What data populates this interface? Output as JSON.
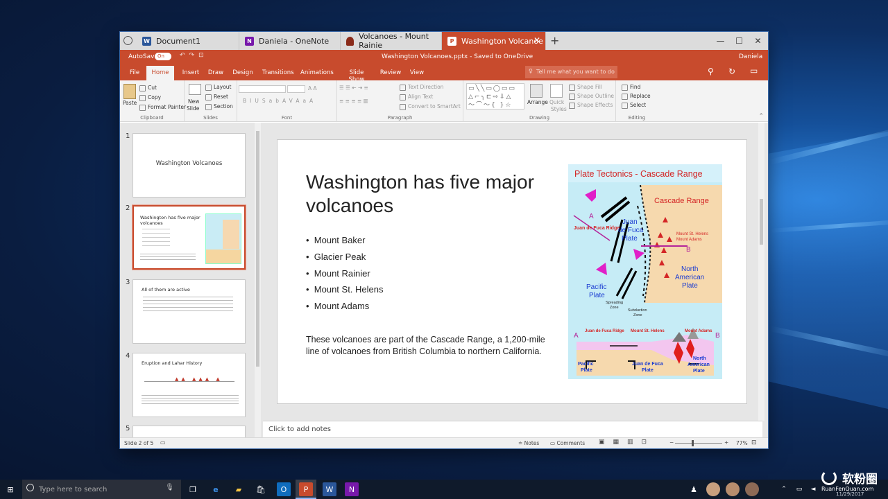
{
  "browser_tabs": [
    {
      "label": "Document1",
      "icon": "word-icon",
      "color": "#2b579a"
    },
    {
      "label": "Daniela - OneNote",
      "icon": "onenote-icon",
      "color": "#7719aa"
    },
    {
      "label": "Volcanoes - Mount Rainie",
      "icon": "shield-icon",
      "color": "#8a2b1a"
    },
    {
      "label": "Washington Volcanoe",
      "icon": "powerpoint-icon",
      "color": "#ffffff"
    }
  ],
  "titlebar": {
    "autosave": "AutoSave",
    "autosave_state": "On",
    "filename": "Washington Volcanoes.pptx - Saved to OneDrive",
    "user": "Daniela"
  },
  "ribbon_tabs": [
    "File",
    "Home",
    "Insert",
    "Draw",
    "Design",
    "Transitions",
    "Animations",
    "Slide Show",
    "Review",
    "View"
  ],
  "tell_me": "Tell me what you want to do",
  "ribbon": {
    "clipboard": {
      "paste": "Paste",
      "cut": "Cut",
      "copy": "Copy",
      "format_painter": "Format Painter",
      "label": "Clipboard"
    },
    "slides": {
      "new_slide_1": "New",
      "new_slide_2": "Slide",
      "layout": "Layout",
      "reset": "Reset",
      "section": "Section",
      "label": "Slides"
    },
    "font": {
      "label": "Font",
      "bold": "B",
      "italic": "I",
      "underline": "U",
      "strike": "S",
      "shadow": "ab",
      "spacing": "AV",
      "case": "Aa",
      "color": "A"
    },
    "paragraph": {
      "text_direction": "Text Direction",
      "align_text": "Align Text",
      "convert": "Convert to SmartArt",
      "label": "Paragraph"
    },
    "drawing": {
      "arrange": "Arrange",
      "quick_1": "Quick",
      "quick_2": "Styles",
      "shape_fill": "Shape Fill",
      "shape_outline": "Shape Outline",
      "shape_effects": "Shape Effects",
      "label": "Drawing"
    },
    "editing": {
      "find": "Find",
      "replace": "Replace",
      "select": "Select",
      "label": "Editing"
    }
  },
  "thumbnails": [
    {
      "num": "1",
      "title": "Washington Volcanoes"
    },
    {
      "num": "2",
      "title": "Washington has five major volcanoes"
    },
    {
      "num": "3",
      "title": "All of them are active"
    },
    {
      "num": "4",
      "title": "Eruption and Lahar History"
    },
    {
      "num": "5",
      "title": ""
    }
  ],
  "slide": {
    "title": "Washington has five major volcanoes",
    "bullets": [
      "Mount Baker",
      "Glacier Peak",
      "Mount Rainier",
      "Mount St. Helens",
      "Mount Adams"
    ],
    "paragraph": "These volcanoes are part of the Cascade Range, a 1,200-mile line of volcanoes from British Columbia to northern California."
  },
  "figure": {
    "title": "Plate Tectonics - Cascade Range",
    "cascade_range": "Cascade Range",
    "a": "A",
    "b": "B",
    "ridge": "Juan de Fuca Ridge",
    "jdf_plate_1": "Juan",
    "jdf_plate_2": "de Fuca",
    "jdf_plate_3": "Plate",
    "st_helens": "Mount St. Helens",
    "mt_adams": "Mount Adams",
    "na_1": "North",
    "na_2": "American",
    "na_3": "Plate",
    "pac_1": "Pacific",
    "pac_2": "Plate",
    "spreading_1": "Spreading",
    "spreading_2": "Zone",
    "subduction_1": "Subduction",
    "subduction_2": "Zone",
    "cs_ridge": "Juan de Fuca Ridge",
    "cs_helens": "Mount St. Helens",
    "cs_adams": "Mount Adams",
    "cs_pac_1": "Pacific",
    "cs_pac_2": "Plate",
    "cs_jdf_1": "Juan de Fuca",
    "cs_jdf_2": "Plate",
    "cs_na_1": "North",
    "cs_na_2": "American",
    "cs_na_3": "Plate"
  },
  "notes_placeholder": "Click to add notes",
  "status": {
    "slide_of": "Slide 2 of 5",
    "notes": "Notes",
    "comments": "Comments",
    "zoom": "77%"
  },
  "taskbar": {
    "search_placeholder": "Type here to search",
    "clock_date": "11/29/2017"
  },
  "watermark": {
    "brand": "软粉圈",
    "site": "RuanFenQuan.com"
  }
}
